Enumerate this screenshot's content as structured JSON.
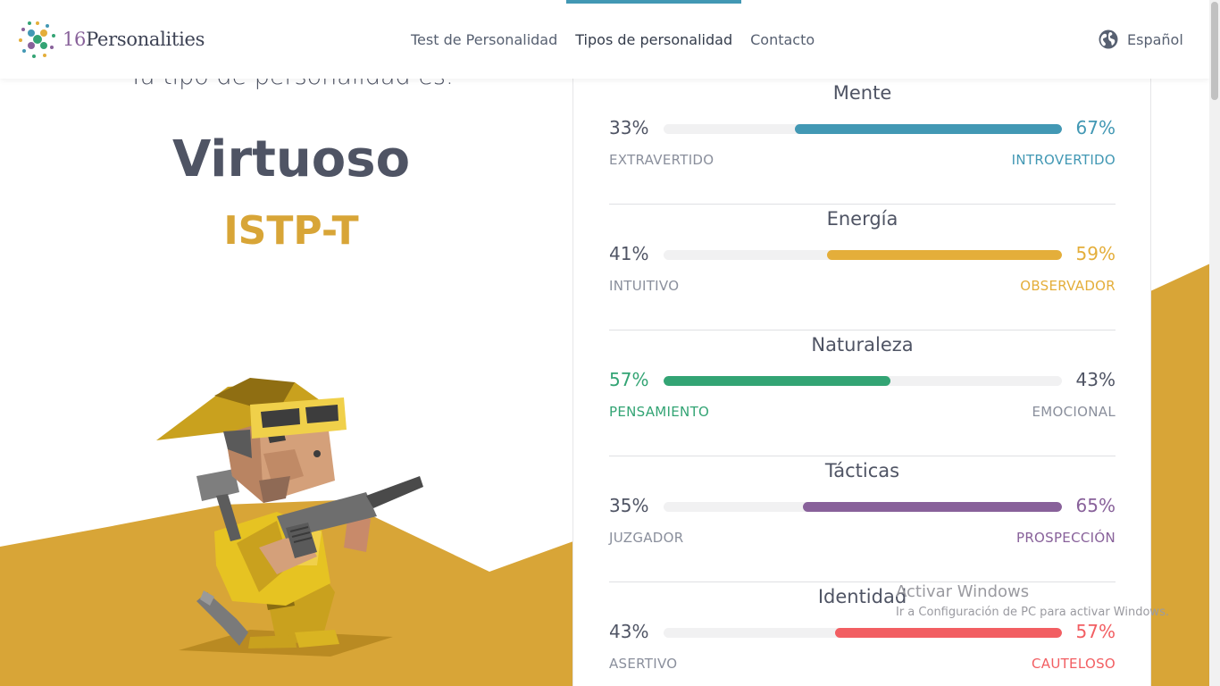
{
  "header": {
    "logo_number": "16",
    "logo_word": "Personalities",
    "nav": [
      {
        "label": "Test de Personalidad",
        "active": false
      },
      {
        "label": "Tipos de personalidad",
        "active": true
      },
      {
        "label": "Contacto",
        "active": false
      }
    ],
    "language": "Español",
    "language_icon": "globe-icon"
  },
  "result": {
    "subtitle": "Tu tipo de personalidad es:",
    "type_name": "Virtuoso",
    "type_code": "ISTP-T"
  },
  "traits": [
    {
      "title": "Mente",
      "left_pct": "33%",
      "right_pct": "67%",
      "left_label": "EXTRAVERTIDO",
      "right_label": "INTROVERTIDO",
      "fill_side": "right",
      "fill_percent": 67,
      "color": "#4298b4"
    },
    {
      "title": "Energía",
      "left_pct": "41%",
      "right_pct": "59%",
      "left_label": "INTUITIVO",
      "right_label": "OBSERVADOR",
      "fill_side": "right",
      "fill_percent": 59,
      "color": "#e4ae3a"
    },
    {
      "title": "Naturaleza",
      "left_pct": "57%",
      "right_pct": "43%",
      "left_label": "PENSAMIENTO",
      "right_label": "EMOCIONAL",
      "fill_side": "left",
      "fill_percent": 57,
      "color": "#33a474"
    },
    {
      "title": "Tácticas",
      "left_pct": "35%",
      "right_pct": "65%",
      "left_label": "JUZGADOR",
      "right_label": "PROSPECCIÓN",
      "fill_side": "right",
      "fill_percent": 65,
      "color": "#88619a"
    },
    {
      "title": "Identidad",
      "left_pct": "43%",
      "right_pct": "57%",
      "left_label": "ASERTIVO",
      "right_label": "CAUTELOSO",
      "fill_side": "right",
      "fill_percent": 57,
      "color": "#f25e62"
    }
  ],
  "watermark": {
    "title": "Activar Windows",
    "subtitle": "Ir a Configuración de PC para activar Windows."
  },
  "colors": {
    "gold_bg": "#d8a537",
    "text_dark": "#4f5464",
    "nav_active_bar": "#4298b4"
  }
}
